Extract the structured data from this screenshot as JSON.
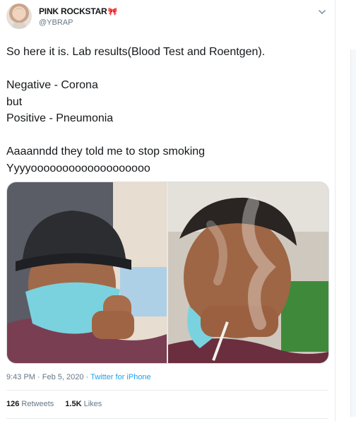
{
  "author": {
    "display_name": "PINK ROCKSTAR",
    "display_name_emoji": "🎀",
    "handle": "@YBRAP"
  },
  "tweet": {
    "text": "So here it is. Lab results(Blood Test and Roentgen).\n\nNegative - Corona\nbut\nPositive - Pneumonia\n\nAaaanndd they told me to stop smoking\nYyyyooooooooooooooooooo",
    "time": "9:43 PM",
    "date": "Feb 5, 2020",
    "separator": "·",
    "source": "Twitter for iPhone"
  },
  "stats": {
    "retweets_count": "126",
    "retweets_label": "Retweets",
    "likes_count": "1.5K",
    "likes_label": "Likes"
  },
  "icons": {
    "menu": "chevron-down-icon"
  },
  "colors": {
    "link": "#1da1f2",
    "secondary_text": "#657786",
    "mask": "#7ad2df"
  }
}
